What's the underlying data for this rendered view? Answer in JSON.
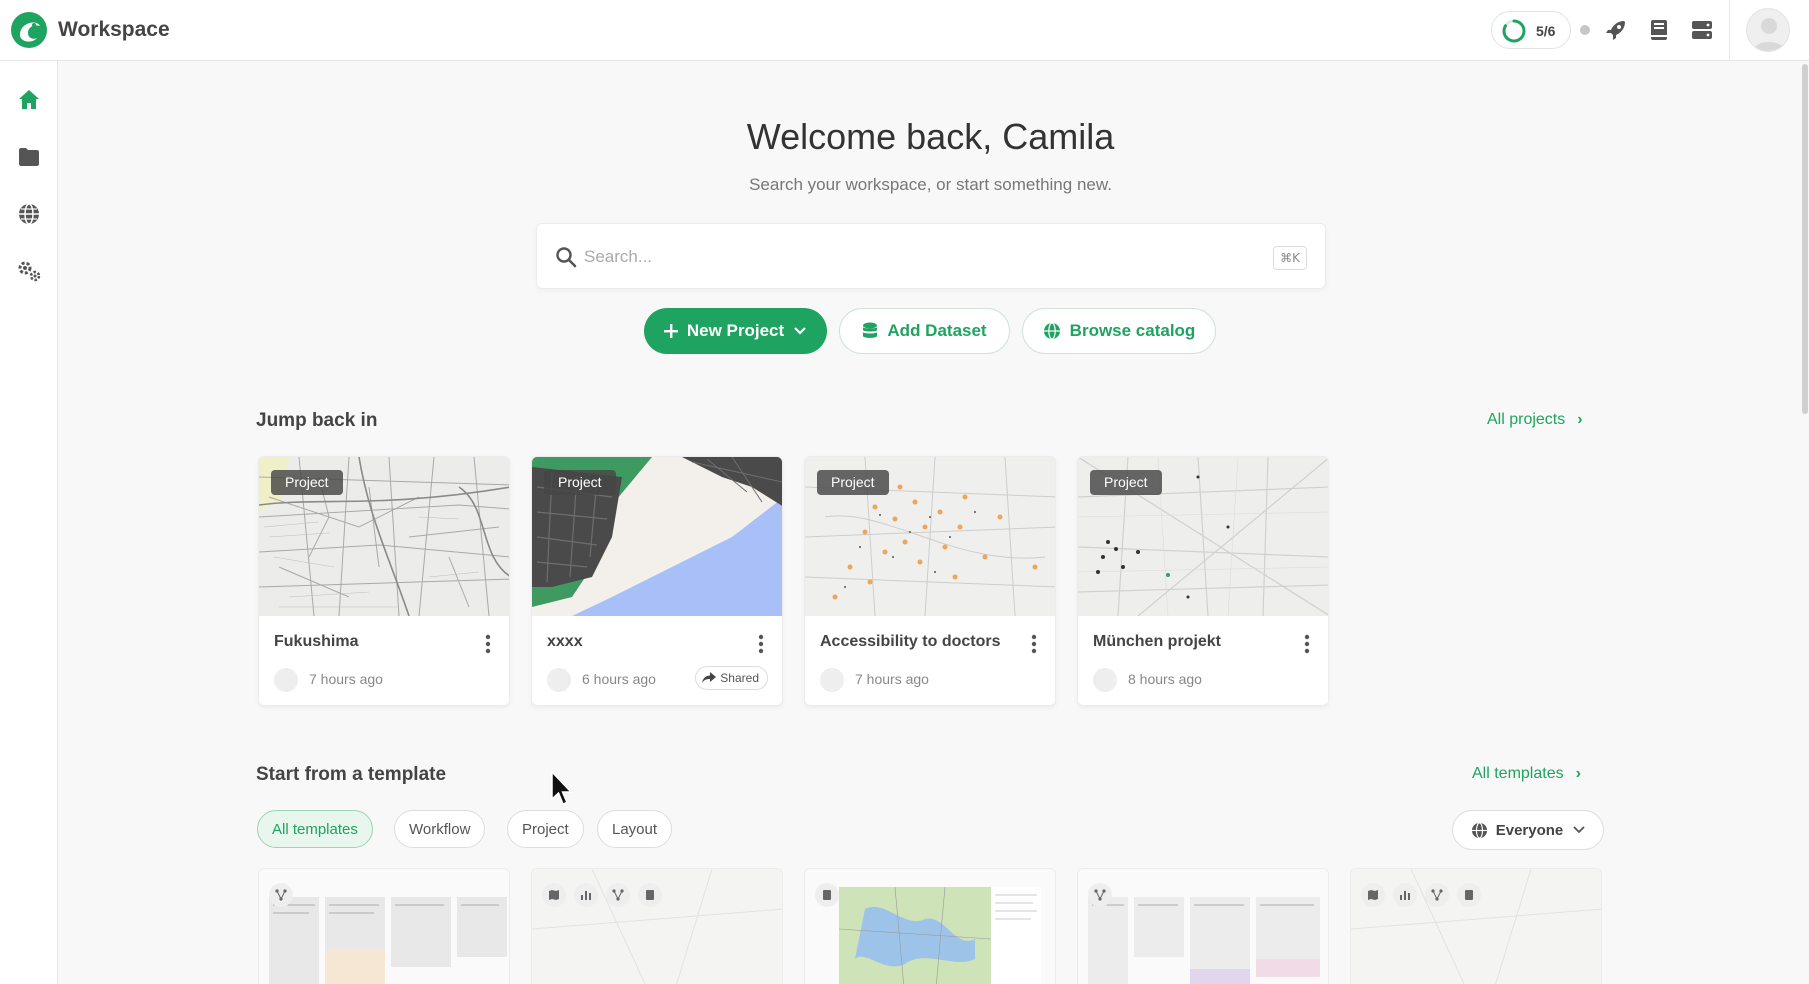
{
  "header": {
    "app_title": "Workspace",
    "progress_text": "5/6",
    "progress_fraction": 0.8333
  },
  "welcome": {
    "title": "Welcome back, Camila",
    "subtitle": "Search your workspace, or start something new."
  },
  "search": {
    "placeholder": "Search...",
    "shortcut": "⌘K"
  },
  "actions": {
    "new_project": "New Project",
    "add_dataset": "Add Dataset",
    "browse_catalog": "Browse catalog"
  },
  "jump_back": {
    "title": "Jump back in",
    "all_link": "All projects",
    "projects": [
      {
        "badge": "Project",
        "name": "Fukushima",
        "time": "7 hours ago"
      },
      {
        "badge": "Project",
        "name": "xxxx",
        "time": "6 hours ago",
        "shared": "Shared"
      },
      {
        "badge": "Project",
        "name": "Accessibility to doctors",
        "time": "7 hours ago"
      },
      {
        "badge": "Project",
        "name": "München projekt",
        "time": "8 hours ago"
      }
    ]
  },
  "templates": {
    "title": "Start from a template",
    "all_link": "All templates",
    "filters": [
      "All templates",
      "Workflow",
      "Project",
      "Layout"
    ],
    "active_filter": "All templates",
    "audience": "Everyone"
  },
  "colors": {
    "accent": "#1fa361",
    "background": "#f8f8f8"
  }
}
